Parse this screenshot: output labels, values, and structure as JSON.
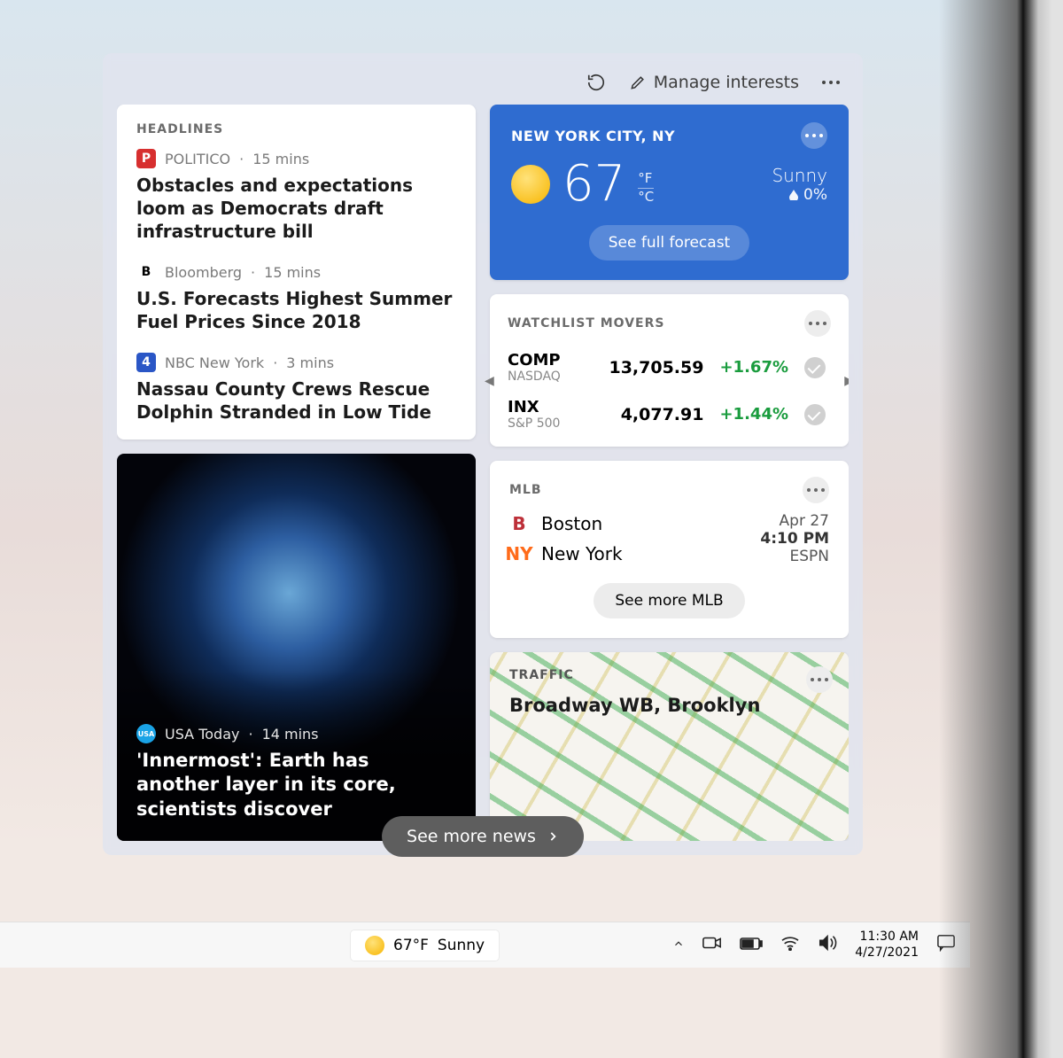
{
  "toolbar": {
    "manage_label": "Manage interests"
  },
  "headlines": {
    "title": "HEADLINES",
    "stories": [
      {
        "source": "POLITICO",
        "time": "15 mins",
        "title": "Obstacles and expectations loom as Democrats draft infrastructure bill",
        "icon_bg": "#d72f2f",
        "icon_txt": "P"
      },
      {
        "source": "Bloomberg",
        "time": "15 mins",
        "title": "U.S. Forecasts Highest Summer Fuel Prices Since 2018",
        "icon_bg": "#ffffff",
        "icon_txt": "B",
        "icon_fg": "#000"
      },
      {
        "source": "NBC New York",
        "time": "3 mins",
        "title": "Nassau County Crews Rescue Dolphin Stranded in Low Tide",
        "icon_bg": "#2a56c6",
        "icon_txt": "4"
      }
    ]
  },
  "feature": {
    "source": "USA Today",
    "time": "14 mins",
    "title": "'Innermost': Earth has another layer in its core, scientists discover"
  },
  "weather": {
    "city": "NEW YORK CITY, NY",
    "temp": "67",
    "unit_f": "°F",
    "unit_c": "°C",
    "condition": "Sunny",
    "humidity": "0%",
    "forecast_btn": "See full forecast"
  },
  "watchlist": {
    "title": "WATCHLIST MOVERS",
    "rows": [
      {
        "symbol": "COMP",
        "exchange": "NASDAQ",
        "price": "13,705.59",
        "change": "+1.67%"
      },
      {
        "symbol": "INX",
        "exchange": "S&P 500",
        "price": "4,077.91",
        "change": "+1.44%"
      }
    ]
  },
  "mlb": {
    "title": "MLB",
    "team1": "Boston",
    "team2": "New York",
    "date": "Apr 27",
    "time": "4:10 PM",
    "network": "ESPN",
    "more_btn": "See more MLB"
  },
  "traffic": {
    "title": "TRAFFIC",
    "location": "Broadway WB, Brooklyn"
  },
  "see_more_news": "See more news",
  "taskbar": {
    "temp": "67°F",
    "cond": "Sunny",
    "time": "11:30 AM",
    "date": "4/27/2021"
  }
}
